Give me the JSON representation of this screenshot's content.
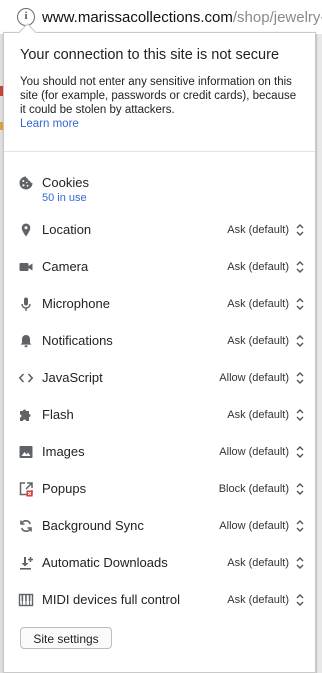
{
  "address_bar": {
    "host": "www.marissacollections.com",
    "path": "/shop/jewelry-"
  },
  "security": {
    "title": "Your connection to this site is not secure",
    "description": "You should not enter any sensitive information on this site (for example, passwords or credit cards), because it could be stolen by attackers.",
    "learn_more": "Learn more"
  },
  "cookies": {
    "label": "Cookies",
    "sub": "50 in use"
  },
  "permissions": [
    {
      "label": "Location",
      "value": "Ask (default)",
      "icon": "location-icon"
    },
    {
      "label": "Camera",
      "value": "Ask (default)",
      "icon": "camera-icon"
    },
    {
      "label": "Microphone",
      "value": "Ask (default)",
      "icon": "microphone-icon"
    },
    {
      "label": "Notifications",
      "value": "Ask (default)",
      "icon": "bell-icon"
    },
    {
      "label": "JavaScript",
      "value": "Allow (default)",
      "icon": "code-icon"
    },
    {
      "label": "Flash",
      "value": "Ask (default)",
      "icon": "puzzle-icon"
    },
    {
      "label": "Images",
      "value": "Allow (default)",
      "icon": "image-icon"
    },
    {
      "label": "Popups",
      "value": "Block (default)",
      "icon": "popup-blocked-icon"
    },
    {
      "label": "Background Sync",
      "value": "Allow (default)",
      "icon": "sync-icon"
    },
    {
      "label": "Automatic Downloads",
      "value": "Ask (default)",
      "icon": "download-icon"
    },
    {
      "label": "MIDI devices full control",
      "value": "Ask (default)",
      "icon": "piano-icon"
    }
  ],
  "site_settings_label": "Site settings",
  "colors": {
    "link": "#3367d6",
    "popup_block_badge": "#d93025"
  }
}
